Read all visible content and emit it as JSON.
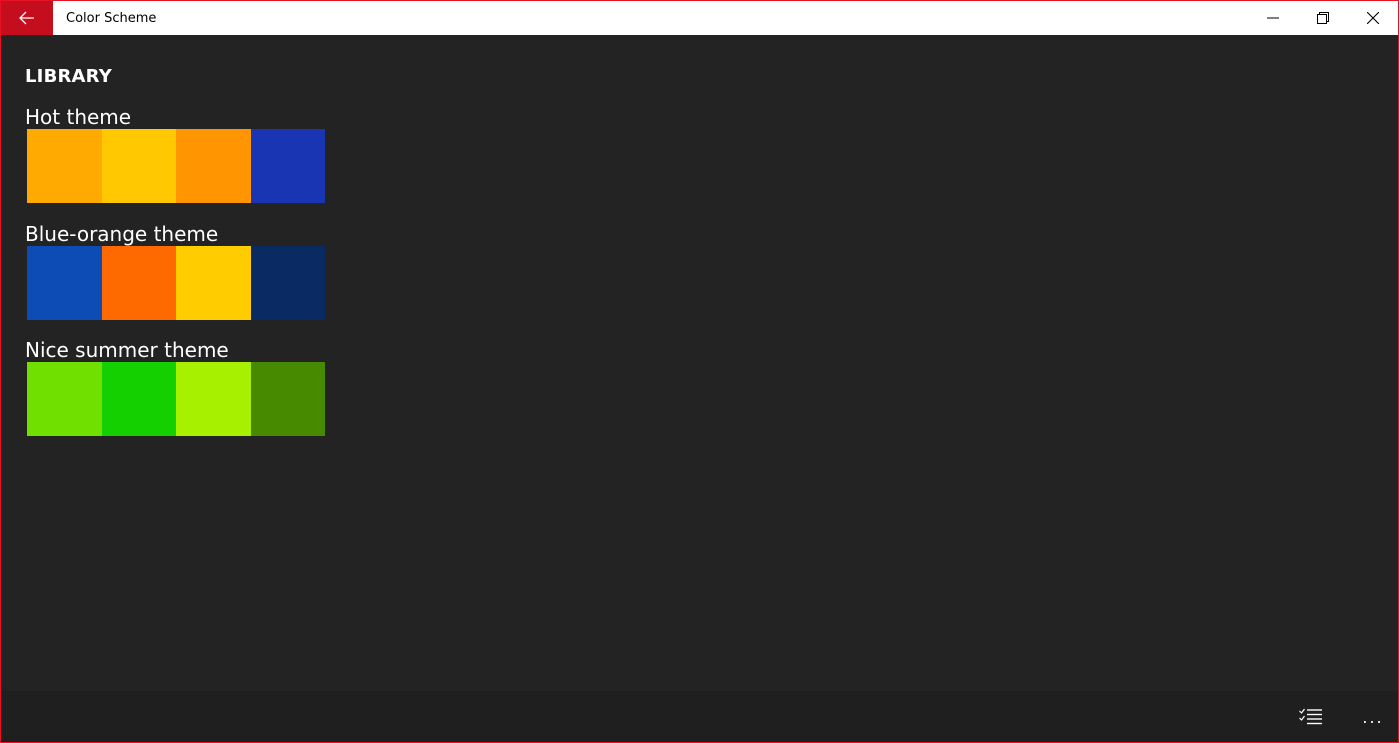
{
  "window": {
    "title": "Color Scheme",
    "accent": "#e81123",
    "back_button_bg": "#c40d1d"
  },
  "icons": {
    "back": "back-arrow-icon",
    "minimize": "minimize-icon",
    "restore": "restore-icon",
    "close": "close-icon",
    "select": "select-list-icon",
    "more": "more-icon"
  },
  "library": {
    "heading": "LIBRARY",
    "themes": [
      {
        "name": "Hot theme",
        "colors": [
          "#ffaa00",
          "#ffc800",
          "#ff9500",
          "#1a35b3"
        ]
      },
      {
        "name": "Blue-orange theme",
        "colors": [
          "#0e4cb5",
          "#ff6a00",
          "#ffcc00",
          "#0a2a63"
        ]
      },
      {
        "name": "Nice summer theme",
        "colors": [
          "#70e000",
          "#14d000",
          "#a6f000",
          "#478a00"
        ]
      }
    ]
  },
  "appbar": {
    "more_label": "..."
  }
}
